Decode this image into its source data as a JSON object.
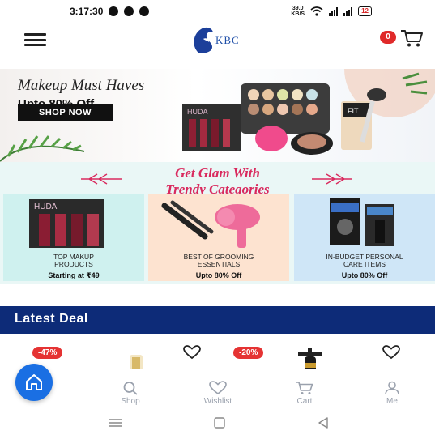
{
  "status_bar": {
    "time": "3:17:30",
    "net_speed_value": "39.0",
    "net_speed_unit": "KB/S",
    "battery": "12"
  },
  "header": {
    "logo_text": "KBC",
    "cart_count": "0"
  },
  "hero": {
    "title": "Makeup Must Haves",
    "subtitle": "Upto 80% Off",
    "button_label": "SHOP NOW",
    "product_label_1": "HUDA",
    "product_label_2": "FIT",
    "product_label_3": "HUDA"
  },
  "categories": {
    "heading_line1": "Get Glam With",
    "heading_line2": "Trendy Categories",
    "items": [
      {
        "name_line1": "TOP MAKUP",
        "name_line2": "PRODUCTS",
        "offer": "Starting at ₹49",
        "brand": "HUDA"
      },
      {
        "name_line1": "BEST OF GROOMING",
        "name_line2": "ESSENTIALS",
        "offer": "Upto 80% Off"
      },
      {
        "name_line1": "IN-BUDGET PERSONAL",
        "name_line2": "CARE ITEMS",
        "offer": "Upto 80% Off"
      }
    ]
  },
  "latest_deal": {
    "title": "Latest Deal",
    "products": [
      {
        "discount": "-47%"
      },
      {
        "discount": "-20%"
      }
    ]
  },
  "bottom_nav": {
    "items": [
      {
        "label": "Shop"
      },
      {
        "label": "Wishlist"
      },
      {
        "label": "Cart"
      },
      {
        "label": "Me"
      }
    ]
  },
  "colors": {
    "brand_blue": "#1a6fe3",
    "deal_bar": "#0d2b78",
    "accent_pink": "#d92a5e",
    "badge_red": "#e02a2a"
  }
}
